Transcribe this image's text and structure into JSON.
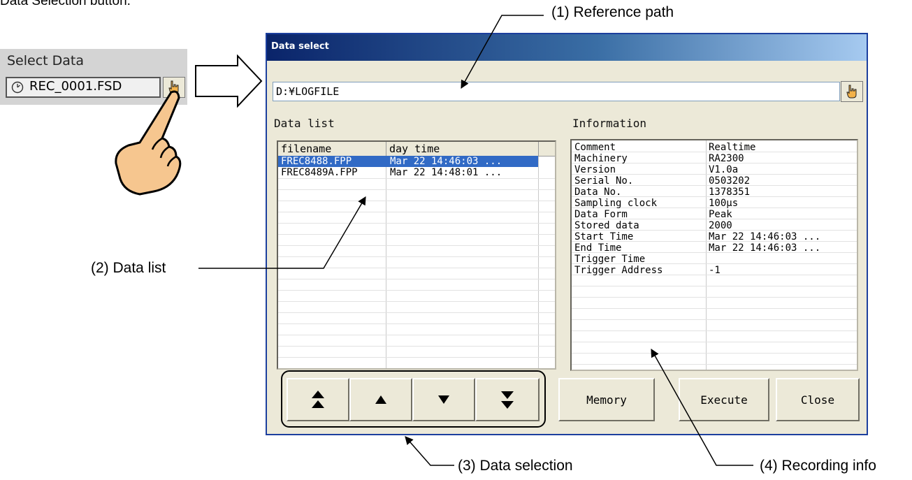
{
  "top_caption": "Data Selection button.",
  "select_widget": {
    "title": "Select Data",
    "file": "REC_0001.FSD"
  },
  "dialog": {
    "title": "Data select",
    "path": "D:¥LOGFILE",
    "data_list_label": "Data list",
    "information_label": "Information",
    "table": {
      "columns": [
        "filename",
        "day time"
      ],
      "rows": [
        {
          "filename": "FREC8488.FPP",
          "day_time": "Mar 22 14:46:03 ...",
          "selected": true
        },
        {
          "filename": "FREC8489A.FPP",
          "day_time": "Mar 22 14:48:01 ...",
          "selected": false
        }
      ]
    },
    "info": [
      {
        "key": "Comment",
        "value": "Realtime"
      },
      {
        "key": "Machinery",
        "value": "RA2300"
      },
      {
        "key": "Version",
        "value": "V1.0a"
      },
      {
        "key": "Serial No.",
        "value": "0503202"
      },
      {
        "key": "Data No.",
        "value": "1378351"
      },
      {
        "key": "Sampling clock",
        "value": "100μs"
      },
      {
        "key": "Data Form",
        "value": "Peak"
      },
      {
        "key": "Stored data",
        "value": "2000"
      },
      {
        "key": "Start Time",
        "value": "Mar 22 14:46:03 ..."
      },
      {
        "key": "End Time",
        "value": "Mar 22 14:46:03 ..."
      },
      {
        "key": "Trigger Time",
        "value": ""
      },
      {
        "key": "Trigger Address",
        "value": "-1"
      }
    ],
    "buttons": {
      "memory": "Memory",
      "execute": "Execute",
      "close": "Close"
    }
  },
  "callouts": {
    "ref_path": "(1) Reference path",
    "data_list": "(2) Data list",
    "data_selection": "(3) Data selection",
    "recording_info": "(4) Recording info"
  },
  "colors": {
    "selection": "#316ac5",
    "titlebar_start": "#0a246a",
    "dialog_bg": "#ece9d8",
    "hand_icon": "#f3b24a"
  }
}
